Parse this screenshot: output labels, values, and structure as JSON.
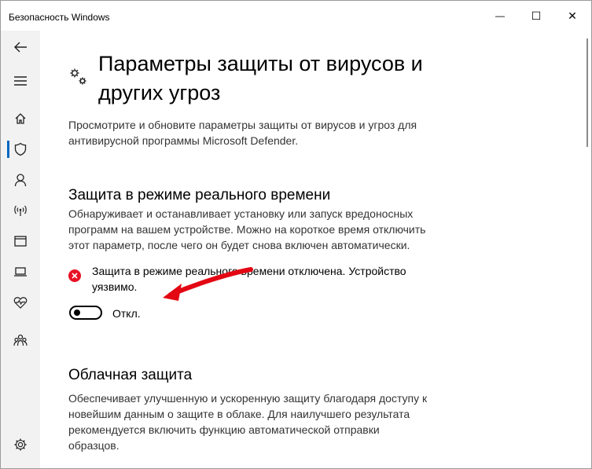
{
  "window": {
    "title": "Безопасность Windows",
    "controls": {
      "minimize": "—",
      "maximize": "☐",
      "close": "✕"
    }
  },
  "sidebar": {
    "items": [
      {
        "icon": "back-arrow-icon"
      },
      {
        "icon": "hamburger-menu-icon"
      },
      {
        "icon": "home-icon"
      },
      {
        "icon": "shield-icon",
        "active": true
      },
      {
        "icon": "person-icon"
      },
      {
        "icon": "wireless-icon"
      },
      {
        "icon": "app-browser-icon"
      },
      {
        "icon": "laptop-icon"
      },
      {
        "icon": "heart-pulse-icon"
      },
      {
        "icon": "family-icon"
      },
      {
        "icon": "settings-gear-icon"
      }
    ],
    "accent": "#0067c0"
  },
  "page": {
    "title": "Параметры защиты от вирусов и других угроз",
    "description_lines": [
      "Просмотрите и обновите параметры защиты от вирусов и угроз для",
      "антивирусной программы Microsoft Defender."
    ]
  },
  "realtime": {
    "heading": "Защита в режиме реального времени",
    "description_lines": [
      "Обнаруживает и останавливает установку или запуск вредоносных",
      "программ на вашем устройстве. Можно на короткое время отключить",
      "этот параметр, после чего он будет снова включен автоматически."
    ],
    "status_lines": [
      "Защита в режиме реального времени отключена. Устройство",
      "уязвимо."
    ],
    "status_color": "#e81123",
    "toggle_on": false,
    "toggle_label": "Откл."
  },
  "cloud": {
    "heading": "Облачная защита",
    "description_lines": [
      "Обеспечивает улучшенную и ускоренную защиту благодаря доступу к",
      "новейшим данным о защите в облаке. Для наилучшего результата",
      "рекомендуется включить функцию автоматической отправки",
      "образцов."
    ]
  },
  "annotation_arrow_color": "#e30613"
}
